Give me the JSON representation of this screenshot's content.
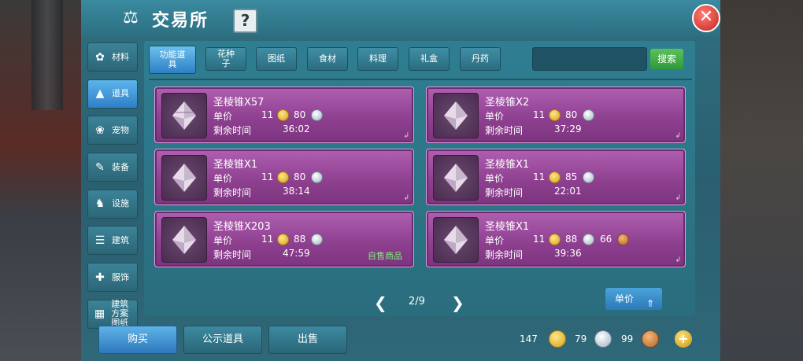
{
  "window": {
    "title": "交易所",
    "help_label": "?",
    "close_label": "✕"
  },
  "side_tabs": [
    {
      "label": "材料",
      "icon": "materials-icon",
      "glyph": "✿"
    },
    {
      "label": "道具",
      "icon": "tools-icon",
      "glyph": "▲"
    },
    {
      "label": "宠物",
      "icon": "paw-icon",
      "glyph": "❀"
    },
    {
      "label": "装备",
      "icon": "sword-icon",
      "glyph": "✎"
    },
    {
      "label": "设施",
      "icon": "horse-icon",
      "glyph": "♞"
    },
    {
      "label": "建筑",
      "icon": "building-icon",
      "glyph": "☰"
    },
    {
      "label": "服饰",
      "icon": "clothing-icon",
      "glyph": "✚"
    },
    {
      "label": "建筑方案图纸",
      "icon": "blueprint-icon",
      "glyph": "▦"
    }
  ],
  "active_side_tab": "道具",
  "top_tabs": [
    "功能道具",
    "花种子",
    "图纸",
    "食材",
    "料理",
    "礼盒",
    "丹药"
  ],
  "active_top_tab": "功能道具",
  "search": {
    "button_label": "搜索",
    "value": ""
  },
  "listings": [
    {
      "name": "圣棱锥X57",
      "price_label": "单价",
      "gold": "11",
      "silver": "80",
      "time_label": "剩余时间",
      "time": "36:02"
    },
    {
      "name": "圣棱锥X2",
      "price_label": "单价",
      "gold": "11",
      "silver": "80",
      "time_label": "剩余时间",
      "time": "37:29"
    },
    {
      "name": "圣棱锥X1",
      "price_label": "单价",
      "gold": "11",
      "silver": "80",
      "time_label": "剩余时间",
      "time": "38:14"
    },
    {
      "name": "圣棱锥X1",
      "price_label": "单价",
      "gold": "11",
      "silver": "85",
      "time_label": "剩余时间",
      "time": "22:01"
    },
    {
      "name": "圣棱锥X203",
      "price_label": "单价",
      "gold": "11",
      "silver": "88",
      "time_label": "剩余时间",
      "time": "47:59",
      "own_label": "自售商品"
    },
    {
      "name": "圣棱锥X1",
      "price_label": "单价",
      "gold": "11",
      "silver": "88",
      "copper": "66",
      "time_label": "剩余时间",
      "time": "39:36"
    }
  ],
  "pagination": {
    "text": "2/9",
    "prev": "❮",
    "next": "❯"
  },
  "sort": {
    "label": "单价",
    "arrow": "⇑"
  },
  "actions": {
    "buy": "购买",
    "show": "公示道具",
    "sell": "出售"
  },
  "currency": {
    "gold": "147",
    "silver": "79",
    "copper": "99",
    "add_label": "+"
  },
  "colors": {
    "panel": "#2f6f80",
    "card": "#9b4c9d",
    "accent_blue": "#2e7fc5",
    "search_green": "#2e9a3b"
  }
}
